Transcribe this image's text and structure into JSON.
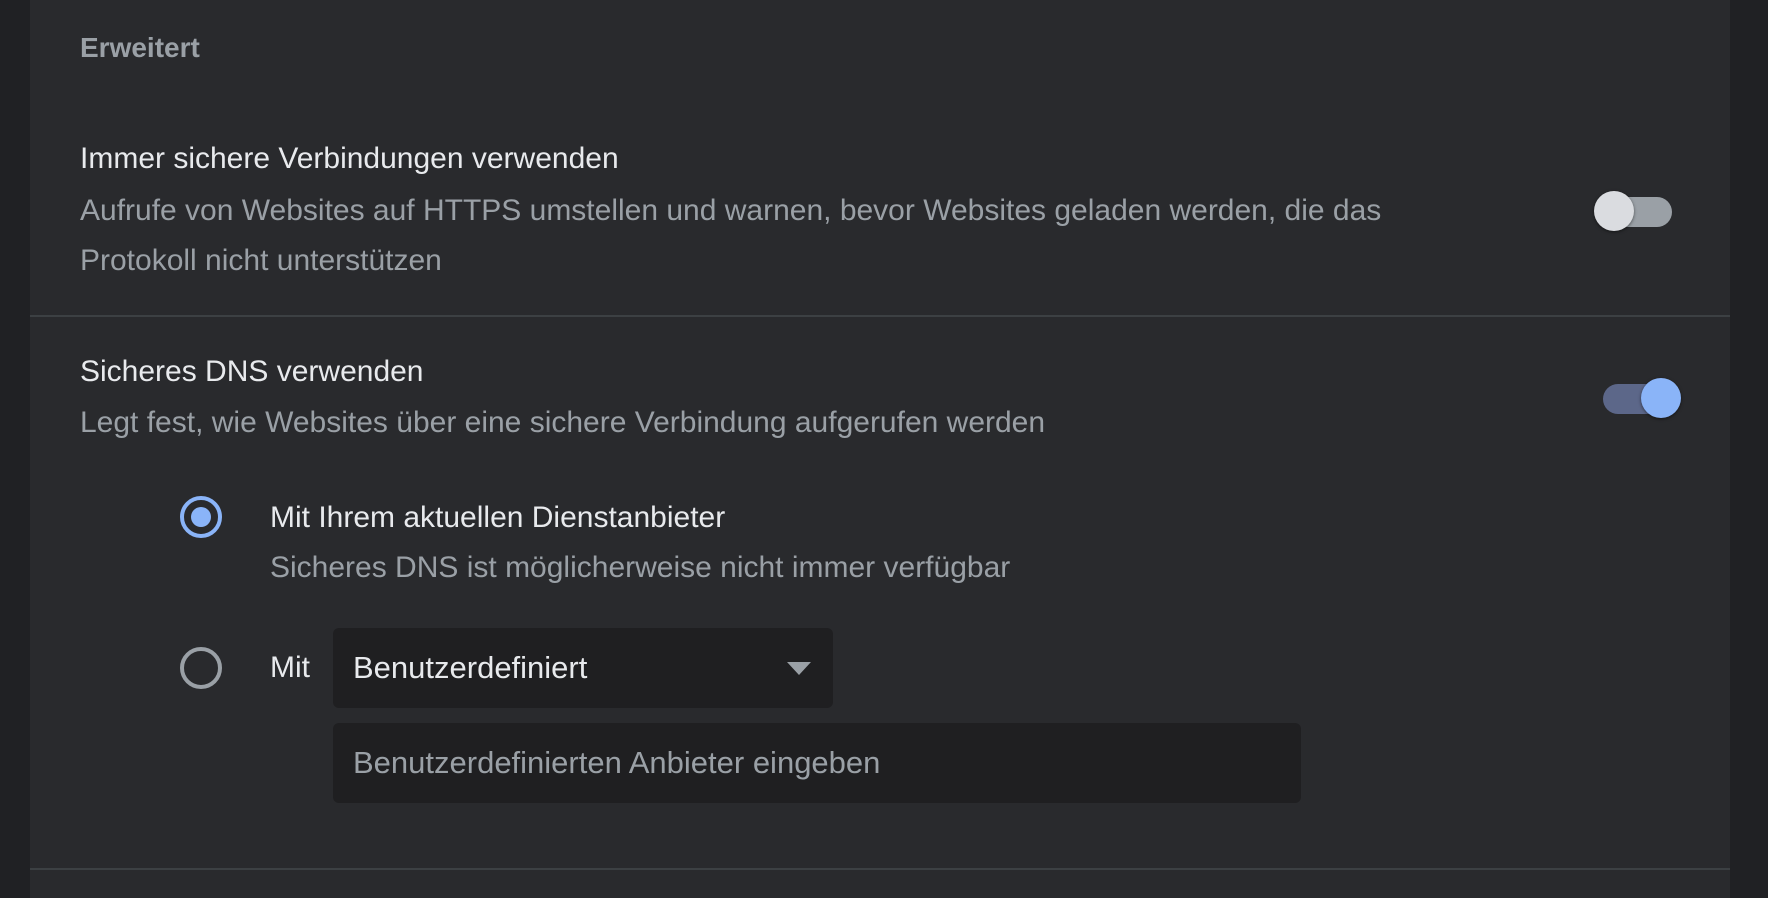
{
  "section": {
    "title": "Erweitert"
  },
  "https_only": {
    "title": "Immer sichere Verbindungen verwenden",
    "desc_line1": "Aufrufe von Websites auf HTTPS umstellen und warnen, bevor Websites geladen werden, die das",
    "desc_line2": "Protokoll nicht unterstützen",
    "enabled": false
  },
  "secure_dns": {
    "title": "Sicheres DNS verwenden",
    "desc": "Legt fest, wie Websites über eine sichere Verbindung aufgerufen werden",
    "enabled": true,
    "option_current": {
      "label": "Mit Ihrem aktuellen Dienstanbieter",
      "sub": "Sicheres DNS ist möglicherweise nicht immer verfügbar",
      "selected": true
    },
    "option_custom": {
      "label": "Mit",
      "selected": false,
      "select_value": "Benutzerdefiniert",
      "input_placeholder": "Benutzerdefinierten Anbieter eingeben",
      "input_value": ""
    }
  },
  "colors": {
    "accent": "#8ab4f8",
    "background": "#202124",
    "card": "#292a2d"
  }
}
